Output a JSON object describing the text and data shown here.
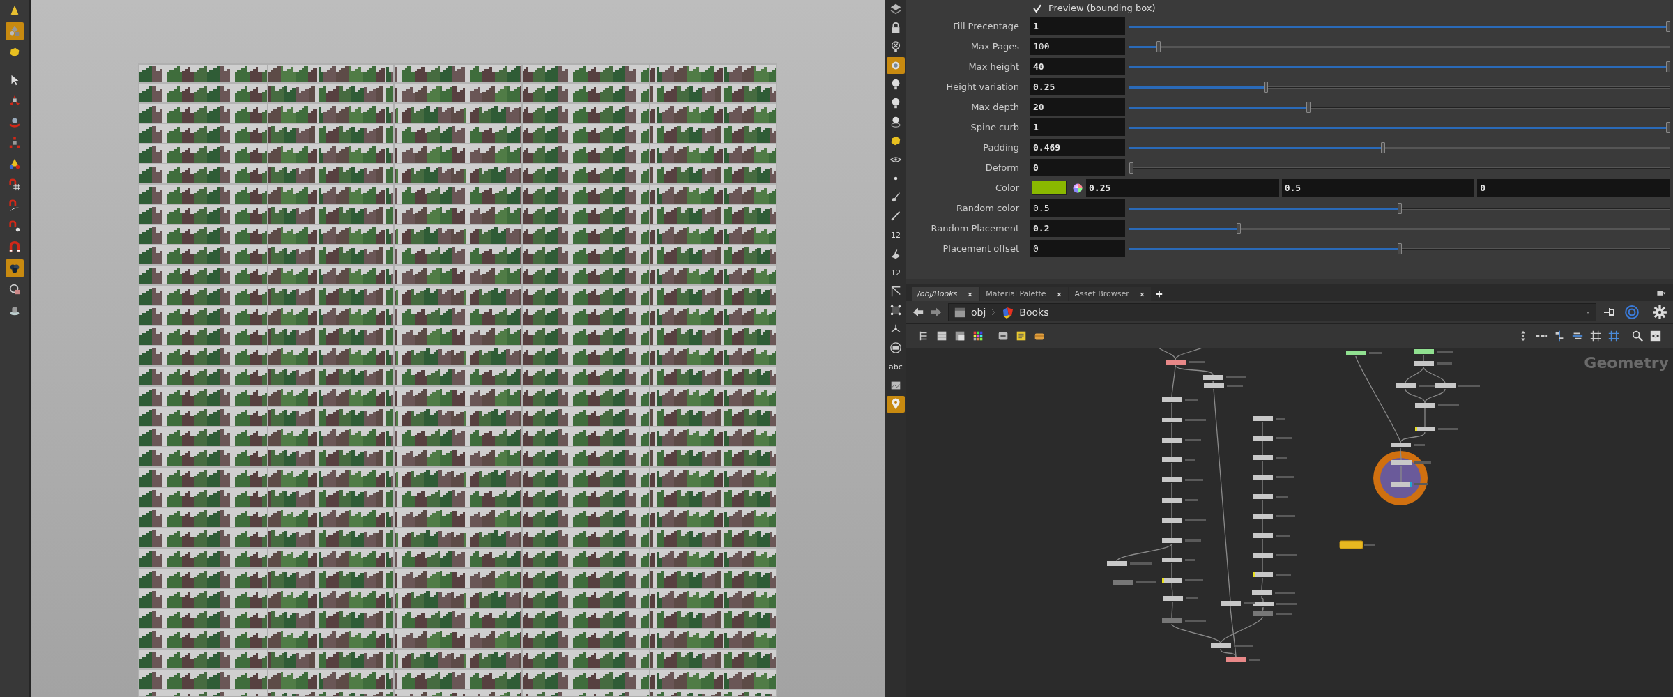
{
  "left_toolbar": [
    {
      "kind": "cone",
      "selected": false
    },
    {
      "kind": "components",
      "selected": true
    },
    {
      "kind": "cube",
      "selected": false
    },
    {
      "kind": "pointer",
      "selected": false
    },
    {
      "kind": "move",
      "selected": false
    },
    {
      "kind": "rotate",
      "selected": false
    },
    {
      "kind": "scale",
      "selected": false
    },
    {
      "kind": "handle",
      "selected": false
    },
    {
      "kind": "snap-grid",
      "selected": false
    },
    {
      "kind": "snap-curve",
      "selected": false
    },
    {
      "kind": "snap-point",
      "selected": false
    },
    {
      "kind": "magnet",
      "selected": false
    },
    {
      "kind": "cluster",
      "selected": true
    },
    {
      "kind": "render",
      "selected": false
    },
    {
      "kind": "teapot",
      "selected": false
    }
  ],
  "display_toolbar": [
    {
      "kind": "layers",
      "selected": false
    },
    {
      "kind": "lock",
      "selected": false
    },
    {
      "kind": "bulb-x",
      "selected": false
    },
    {
      "kind": "camera",
      "selected": true
    },
    {
      "kind": "bulb",
      "selected": false
    },
    {
      "kind": "bulb",
      "selected": false
    },
    {
      "kind": "bulb-ring",
      "selected": false
    },
    {
      "kind": "cube",
      "selected": false
    },
    {
      "kind": "eye",
      "selected": false
    },
    {
      "kind": "dot",
      "selected": false
    },
    {
      "kind": "brush",
      "selected": false
    },
    {
      "kind": "pin",
      "selected": false
    },
    {
      "kind": "number",
      "label": "12",
      "selected": false
    },
    {
      "kind": "paint",
      "selected": false
    },
    {
      "kind": "number",
      "label": "12",
      "selected": false
    },
    {
      "kind": "angle",
      "selected": false
    },
    {
      "kind": "bounds",
      "selected": false
    },
    {
      "kind": "normals",
      "selected": false
    },
    {
      "kind": "disc",
      "selected": false
    },
    {
      "kind": "text",
      "label": "abc",
      "selected": false
    },
    {
      "kind": "image",
      "selected": false
    },
    {
      "kind": "marker",
      "selected": true
    }
  ],
  "parameters": {
    "preview": {
      "label": "Preview (bounding box)",
      "checked": true
    },
    "rows": [
      {
        "kind": "slider",
        "label": "Fill Precentage",
        "value": "1",
        "changed": true,
        "level": 1
      },
      {
        "kind": "slider",
        "label": "Max Pages",
        "value": "100",
        "changed": false,
        "level": 0.05
      },
      {
        "kind": "slider",
        "label": "Max height",
        "value": "40",
        "changed": true,
        "level": 1
      },
      {
        "kind": "slider",
        "label": "Height variation",
        "value": "0.25",
        "changed": true,
        "level": 0.25
      },
      {
        "kind": "slider",
        "label": "Max depth",
        "value": "20",
        "changed": true,
        "level": 0.33
      },
      {
        "kind": "slider",
        "label": "Spine curb",
        "value": "1",
        "changed": true,
        "level": 1
      },
      {
        "kind": "slider",
        "label": "Padding",
        "value": "0.469",
        "changed": true,
        "level": 0.469
      },
      {
        "kind": "slider",
        "label": "Deform",
        "value": "0",
        "changed": true,
        "level": 0
      },
      {
        "kind": "color",
        "label": "Color",
        "color": "#8ab800",
        "components": [
          "0.25",
          "0.5",
          "0"
        ]
      },
      {
        "kind": "slider",
        "label": "Random color",
        "value": "0.5",
        "changed": false,
        "level": 0.5
      },
      {
        "kind": "slider",
        "label": "Random Placement",
        "value": "0.2",
        "changed": true,
        "level": 0.2
      },
      {
        "kind": "slider",
        "label": "Placement offset",
        "value": "0",
        "changed": false,
        "level": 0.5
      }
    ]
  },
  "tabs": [
    {
      "label": "/obj/Books",
      "selected": true
    },
    {
      "label": "Material Palette",
      "selected": false
    },
    {
      "label": "Asset Browser",
      "selected": false
    }
  ],
  "path": [
    "obj",
    "Books"
  ],
  "network_type_label": "Geometry"
}
